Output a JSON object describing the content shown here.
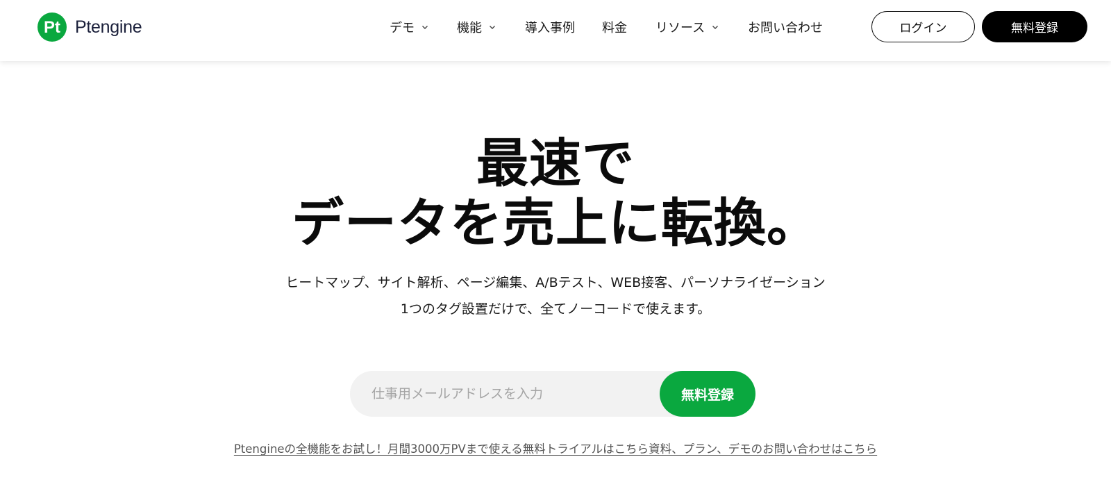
{
  "brand": {
    "name": "Ptengine",
    "logo_mark": "Pt",
    "accent_color": "#0aa83f"
  },
  "nav": {
    "items": [
      {
        "label": "デモ",
        "has_dropdown": true
      },
      {
        "label": "機能",
        "has_dropdown": true
      },
      {
        "label": "導入事例",
        "has_dropdown": false
      },
      {
        "label": "料金",
        "has_dropdown": false
      },
      {
        "label": "リソース",
        "has_dropdown": true
      },
      {
        "label": "お問い合わせ",
        "has_dropdown": false
      }
    ],
    "dropdown_icon": "chevron-down-icon",
    "login_label": "ログイン",
    "signup_label": "無料登録"
  },
  "hero": {
    "title_line1": "最速で",
    "title_line2": "データを売上に転換。",
    "subtitle_line1": "ヒートマップ、サイト解析、ページ編集、A/Bテスト、WEB接客、パーソナライゼーション",
    "subtitle_line2": "1つのタグ設置だけで、全てノーコードで使えます。"
  },
  "signup_form": {
    "email_placeholder": "仕事用メールアドレスを入力",
    "email_value": "",
    "submit_label": "無料登録"
  },
  "links": {
    "trial": "Ptengineの全機能をお試し！月間3000万PVまで使える無料トライアルはこちら",
    "contact": "資料、プラン、デモのお問い合わせはこちら"
  }
}
